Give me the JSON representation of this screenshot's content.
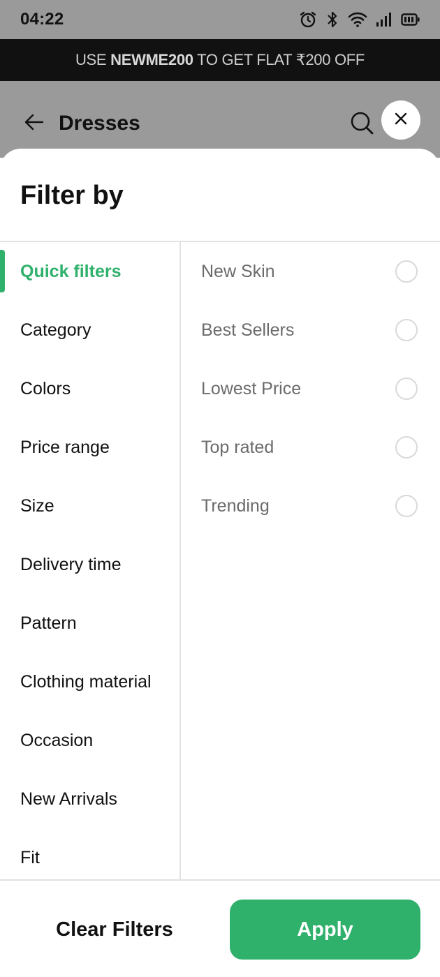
{
  "status_bar": {
    "time": "04:22",
    "icons": [
      "alarm-icon",
      "bluetooth-icon",
      "wifi-icon",
      "signal-icon",
      "battery-icon"
    ]
  },
  "promo": {
    "prefix": "USE ",
    "code": "NEWME200",
    "suffix": " TO GET FLAT ₹200 OFF"
  },
  "header": {
    "title": "Dresses"
  },
  "filter_sheet": {
    "title": "Filter by",
    "categories": [
      {
        "label": "Quick filters",
        "active": true
      },
      {
        "label": "Category",
        "active": false
      },
      {
        "label": "Colors",
        "active": false
      },
      {
        "label": "Price range",
        "active": false
      },
      {
        "label": "Size",
        "active": false
      },
      {
        "label": "Delivery time",
        "active": false
      },
      {
        "label": "Pattern",
        "active": false
      },
      {
        "label": "Clothing material",
        "active": false
      },
      {
        "label": "Occasion",
        "active": false
      },
      {
        "label": "New Arrivals",
        "active": false
      },
      {
        "label": "Fit",
        "active": false
      }
    ],
    "options": [
      {
        "label": "New Skin",
        "selected": false
      },
      {
        "label": "Best Sellers",
        "selected": false
      },
      {
        "label": "Lowest Price",
        "selected": false
      },
      {
        "label": "Top rated",
        "selected": false
      },
      {
        "label": "Trending",
        "selected": false
      }
    ]
  },
  "footer": {
    "clear_label": "Clear Filters",
    "apply_label": "Apply"
  },
  "colors": {
    "accent": "#2fb16c",
    "overlay": "#9a9a9a",
    "banner": "#111111"
  }
}
